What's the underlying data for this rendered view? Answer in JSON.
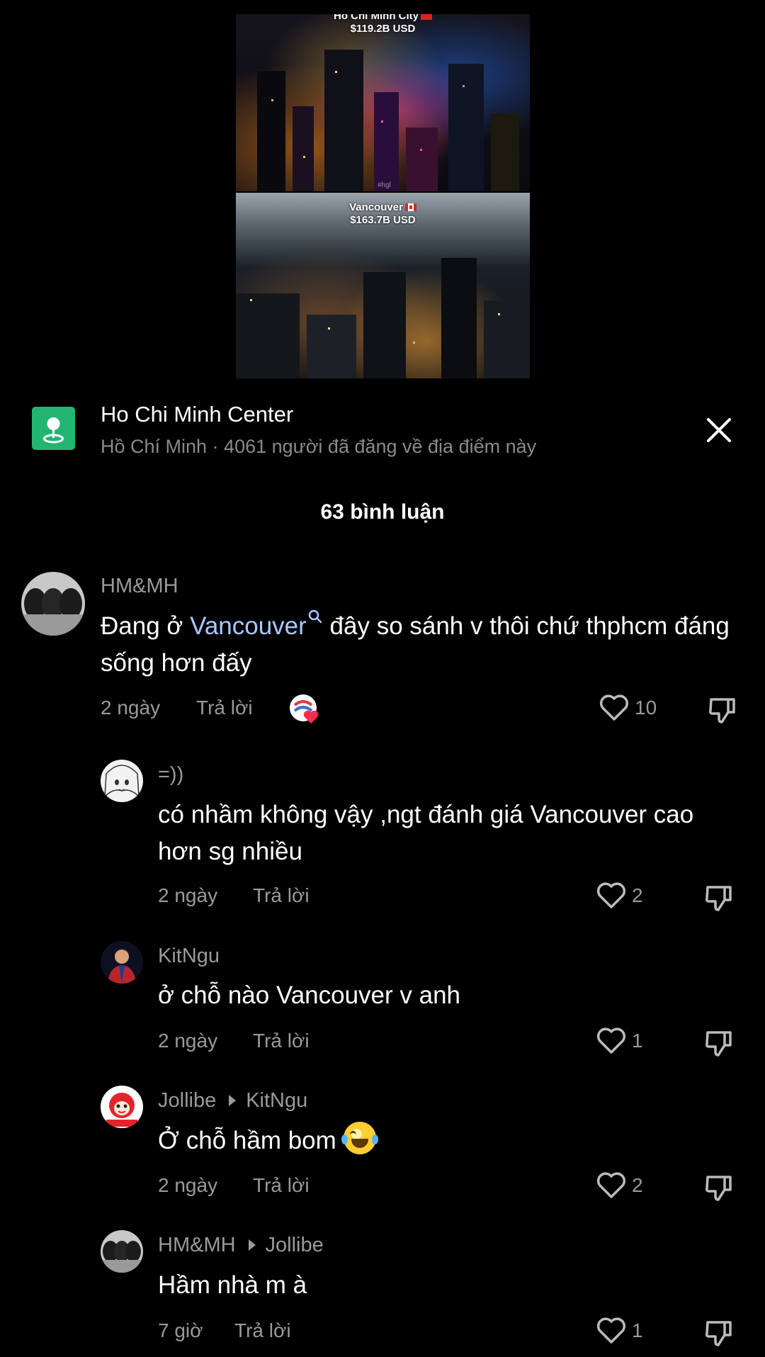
{
  "video": {
    "top_city": "Ho Chi Minh City",
    "top_value": "$119.2B USD",
    "bottom_city": "Vancouver",
    "bottom_value": "$163.7B USD",
    "watermark": "#hgl"
  },
  "location": {
    "title": "Ho Chi Minh Center",
    "subtitle": "Hồ Chí Minh · 4061 người đã đăng về địa điểm này",
    "icon": "map-pin-icon",
    "icon_color": "#22b572"
  },
  "comments_count": "63 bình luận",
  "reply_label": "Trả lời",
  "comments": [
    {
      "username": "HM&MH",
      "text_before": "Đang ở ",
      "link": "Vancouver",
      "text_after": " đây so sánh v thôi chứ thphcm đáng sống hơn đấy",
      "time": "2 ngày",
      "likes": "10"
    },
    {
      "username": "=))",
      "text": "có nhầm không vậy ,ngt đánh giá Vancouver cao hơn sg nhiều",
      "time": "2 ngày",
      "likes": "2"
    },
    {
      "username": "KitNgu",
      "text": "ở chỗ nào Vancouver v anh",
      "time": "2 ngày",
      "likes": "1"
    },
    {
      "username": "Jollibe",
      "reply_to": "KitNgu",
      "text": "Ở chỗ hầm bom",
      "time": "2 ngày",
      "likes": "2"
    },
    {
      "username": "HM&MH",
      "reply_to": "Jollibe",
      "text": "Hầm nhà m à",
      "time": "7 giờ",
      "likes": "1"
    }
  ]
}
